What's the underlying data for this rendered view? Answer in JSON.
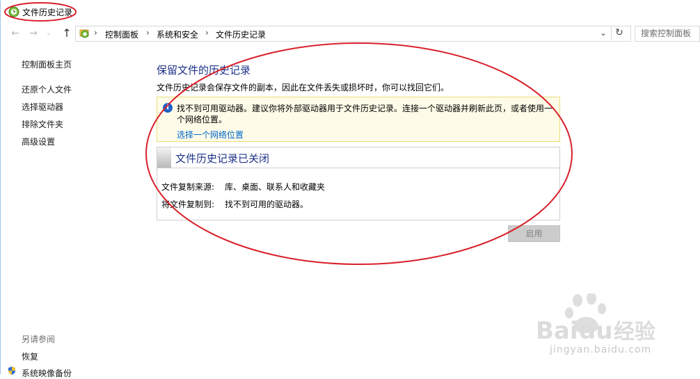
{
  "window": {
    "title": "文件历史记录"
  },
  "address": {
    "crumbs": [
      "控制面板",
      "系统和安全",
      "文件历史记录"
    ],
    "search_placeholder": "搜索控制面板"
  },
  "nav": {
    "home": "控制面板主页",
    "items": [
      "还原个人文件",
      "选择驱动器",
      "排除文件夹",
      "高级设置"
    ],
    "see_also_heading": "另请参阅",
    "see_also": [
      "恢复",
      "系统映像备份"
    ]
  },
  "main": {
    "title": "保留文件的历史记录",
    "description": "文件历史记录会保存文件的副本，因此在文件丢失或损坏时，你可以找回它们。",
    "info": {
      "message": "找不到可用驱动器。建议你将外部驱动器用于文件历史记录。连接一个驱动器并刷新此页，或者使用一个网络位置。",
      "link": "选择一个网络位置"
    },
    "status": {
      "title": "文件历史记录已关闭",
      "rows": [
        {
          "label": "文件复制来源:",
          "value": "库、桌面、联系人和收藏夹"
        },
        {
          "label": "将文件复制到:",
          "value": "找不到可用的驱动器。"
        }
      ]
    },
    "enable_button": "启用"
  },
  "watermark": {
    "text": "jingyan.baidu.com",
    "brand": "Baidu 经验"
  },
  "icons": {
    "back": "back-arrow-icon",
    "forward": "forward-arrow-icon",
    "up": "up-arrow-icon",
    "refresh": "refresh-icon",
    "info": "info-icon",
    "shield": "shield-icon",
    "app": "file-history-icon"
  },
  "colors": {
    "accent_title": "#1e3287",
    "link": "#0066cc",
    "info_bg": "#fefce8",
    "annotation": "#d9202a"
  }
}
